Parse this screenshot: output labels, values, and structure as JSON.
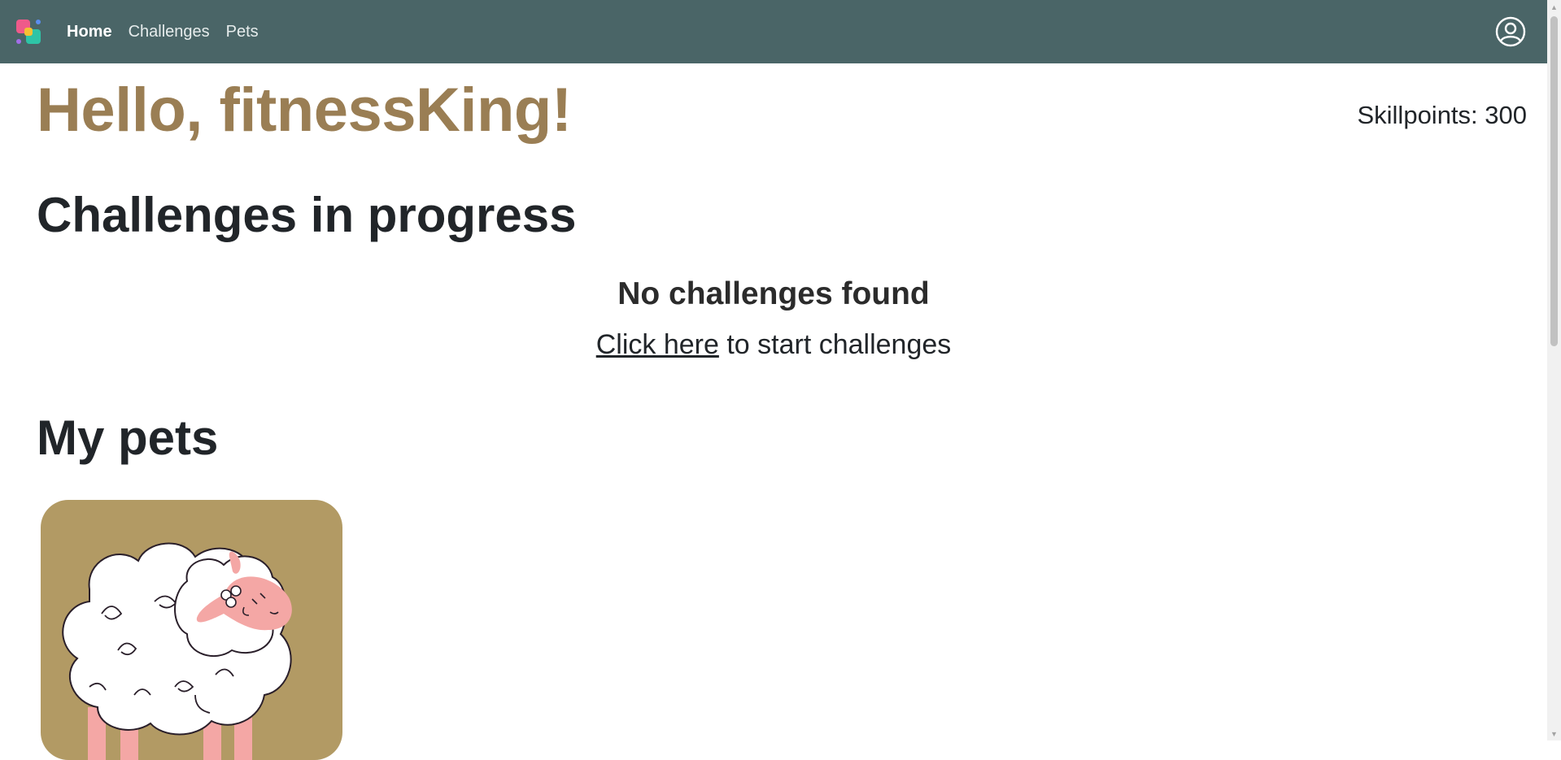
{
  "nav": {
    "brand_icon": "app-logo-icon",
    "links": [
      {
        "label": "Home",
        "active": true
      },
      {
        "label": "Challenges",
        "active": false
      },
      {
        "label": "Pets",
        "active": false
      }
    ],
    "user_icon": "user-circle-icon"
  },
  "greeting": "Hello, fitnessKing!",
  "skillpoints": "Skillpoints: 300",
  "challenges": {
    "title": "Challenges in progress",
    "empty_title": "No challenges found",
    "link_text": "Click here",
    "link_suffix": " to start challenges"
  },
  "pets": {
    "title": "My pets",
    "items": [
      {
        "icon": "sheep-illustration",
        "background": "#b29a64"
      }
    ]
  },
  "colors": {
    "navbar": "#4a6567",
    "accent": "#9a7e54",
    "card": "#b29a64"
  }
}
